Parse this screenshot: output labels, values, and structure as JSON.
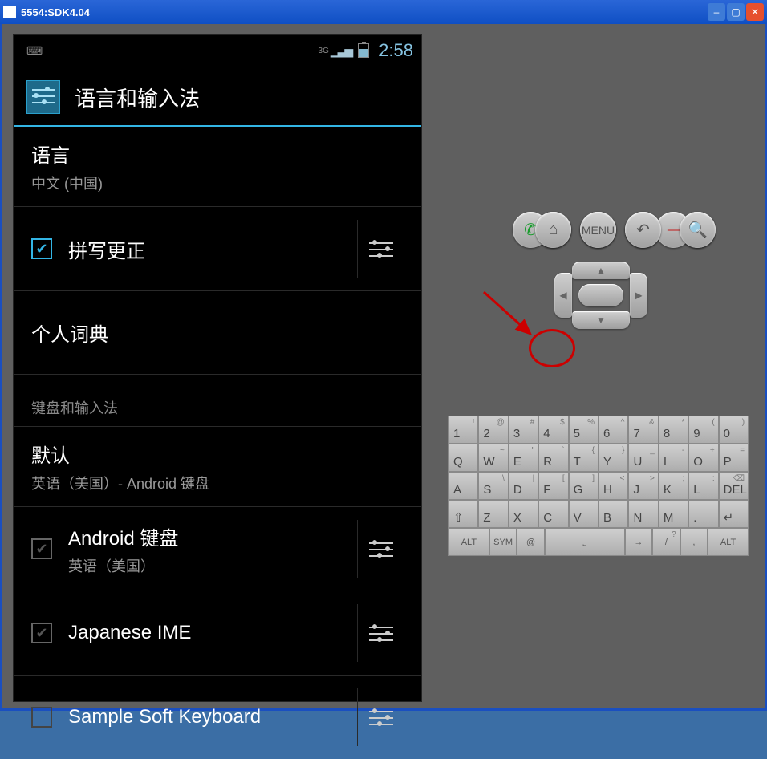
{
  "window": {
    "title": "5554:SDK4.04"
  },
  "statusbar": {
    "network": "3G",
    "clock": "2:58"
  },
  "header": {
    "title": "语言和输入法"
  },
  "rows": {
    "language": {
      "title": "语言",
      "sub": "中文 (中国)"
    },
    "spell": {
      "title": "拼写更正"
    },
    "dict": {
      "title": "个人词典"
    },
    "cat_kbd": "键盘和输入法",
    "default": {
      "title": "默认",
      "sub": "英语（美国）- Android 键盘"
    },
    "android_kbd": {
      "title": "Android 键盘",
      "sub": "英语（美国）"
    },
    "jp_ime": {
      "title": "Japanese IME"
    },
    "sample": {
      "title": "Sample Soft Keyboard"
    }
  },
  "ctrl": {
    "menu": "MENU"
  },
  "keys": {
    "r1": [
      {
        "m": "1",
        "s": "!"
      },
      {
        "m": "2",
        "s": "@"
      },
      {
        "m": "3",
        "s": "#"
      },
      {
        "m": "4",
        "s": "$"
      },
      {
        "m": "5",
        "s": "%"
      },
      {
        "m": "6",
        "s": "^"
      },
      {
        "m": "7",
        "s": "&"
      },
      {
        "m": "8",
        "s": "*"
      },
      {
        "m": "9",
        "s": "("
      },
      {
        "m": "0",
        "s": ")"
      }
    ],
    "r2": [
      {
        "m": "Q",
        "s": ""
      },
      {
        "m": "W",
        "s": "~"
      },
      {
        "m": "E",
        "s": "\""
      },
      {
        "m": "R",
        "s": "`"
      },
      {
        "m": "T",
        "s": "{"
      },
      {
        "m": "Y",
        "s": "}"
      },
      {
        "m": "U",
        "s": "_"
      },
      {
        "m": "I",
        "s": "-"
      },
      {
        "m": "O",
        "s": "+"
      },
      {
        "m": "P",
        "s": "="
      }
    ],
    "r3": [
      {
        "m": "A",
        "s": ""
      },
      {
        "m": "S",
        "s": "\\"
      },
      {
        "m": "D",
        "s": "|"
      },
      {
        "m": "F",
        "s": "["
      },
      {
        "m": "G",
        "s": "]"
      },
      {
        "m": "H",
        "s": "<"
      },
      {
        "m": "J",
        "s": ">"
      },
      {
        "m": "K",
        "s": ";"
      },
      {
        "m": "L",
        "s": ":"
      },
      {
        "m": "DEL",
        "s": "⌫"
      }
    ],
    "r4": [
      {
        "m": "⇧",
        "s": ""
      },
      {
        "m": "Z",
        "s": ""
      },
      {
        "m": "X",
        "s": ""
      },
      {
        "m": "C",
        "s": ""
      },
      {
        "m": "V",
        "s": ""
      },
      {
        "m": "B",
        "s": ""
      },
      {
        "m": "N",
        "s": ""
      },
      {
        "m": "M",
        "s": ""
      },
      {
        "m": ".",
        "s": ""
      },
      {
        "m": "↵",
        "s": ""
      }
    ],
    "r5": {
      "alt": "ALT",
      "sym": "SYM",
      "at": "@",
      "comma": ",",
      "slash": "/",
      "q": "?",
      "space": "⎵",
      "arrow": "→"
    }
  }
}
